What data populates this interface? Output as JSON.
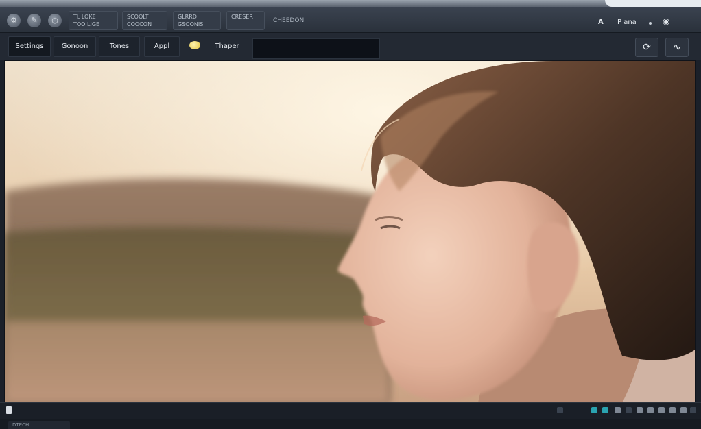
{
  "toolbar": {
    "icons": [
      "tool-icon",
      "brush-icon",
      "globe-icon"
    ],
    "group1": {
      "line1": "TL   LOKE",
      "line2": "TOO  LIGE"
    },
    "group2": {
      "line1": "SCOOLT",
      "line2": "COOCON"
    },
    "group3": {
      "line1": "GLRRD",
      "line2": "GSOONIS"
    },
    "group4": {
      "line1": "CRESER",
      "line2": ""
    },
    "group5_text": "CHEEDON"
  },
  "topright": {
    "a_label": "A",
    "menu_label": "P ana",
    "dot_glyph": "•"
  },
  "tabs": [
    "Settings",
    "Gonoon",
    "Tones",
    "Appl",
    "Thaper"
  ],
  "right_buttons": [
    "rotate-icon",
    "wand-icon"
  ],
  "viewer": {
    "image_description": "woman-profile-photo"
  },
  "bottom": {
    "tab_label": "DTECH"
  },
  "colors": {
    "accent": "#2aa3b0",
    "background": "#1b2029"
  }
}
